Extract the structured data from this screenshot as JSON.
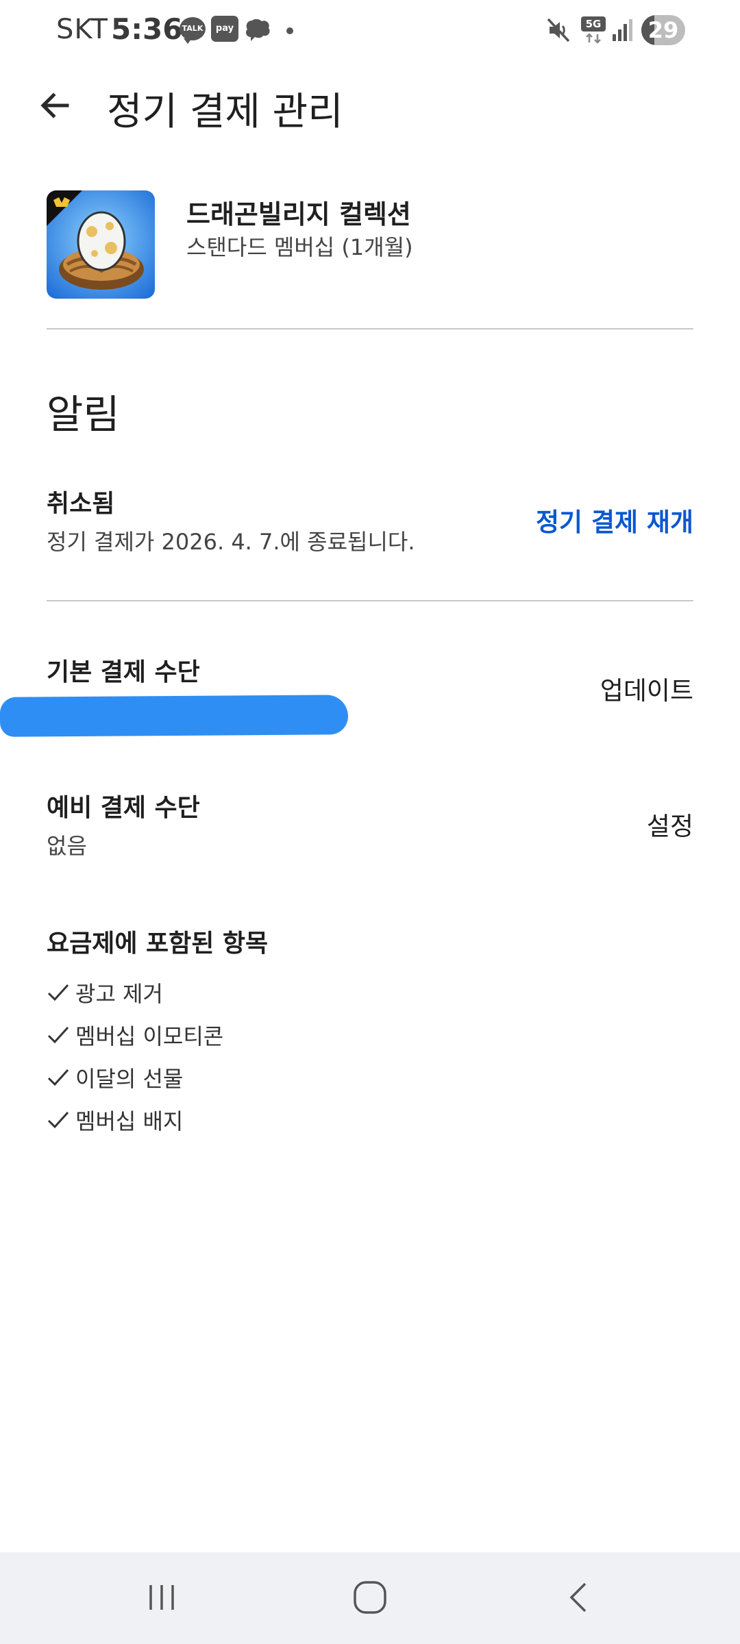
{
  "status_bar": {
    "carrier": "SKT",
    "time": "5:36",
    "talk_label": "TALK",
    "pay_label": "pay",
    "network": "5G",
    "battery": "29",
    "battery_level": 0.29
  },
  "header": {
    "title": "정기 결제 관리"
  },
  "app": {
    "name": "드래곤빌리지 컬렉션",
    "plan": "스탠다드 멤버십 (1개월)"
  },
  "notifications": {
    "section_title": "알림",
    "status_title": "취소됨",
    "status_detail": "정기 결제가 2026. 4. 7.에 종료됩니다.",
    "resume_action": "정기 결제 재개"
  },
  "payment": {
    "primary_title": "기본 결제 수단",
    "primary_update": "업데이트",
    "backup_title": "예비 결제 수단",
    "backup_value": "없음",
    "backup_action": "설정"
  },
  "plan_includes": {
    "title": "요금제에 포함된 항목",
    "items": [
      "광고 제거",
      "멤버십 이모티콘",
      "이달의 선물",
      "멤버십 배지"
    ]
  },
  "colors": {
    "accent": "#0b57d0",
    "redaction": "#2f8ef3",
    "divider": "#c8c8c8",
    "nav_bg": "#eff1f5"
  },
  "icons": {
    "back": "arrow-left-icon",
    "check": "checkmark-icon",
    "nav_recent": "recent-apps-icon",
    "nav_home": "home-icon",
    "nav_back": "back-chevron-icon"
  }
}
